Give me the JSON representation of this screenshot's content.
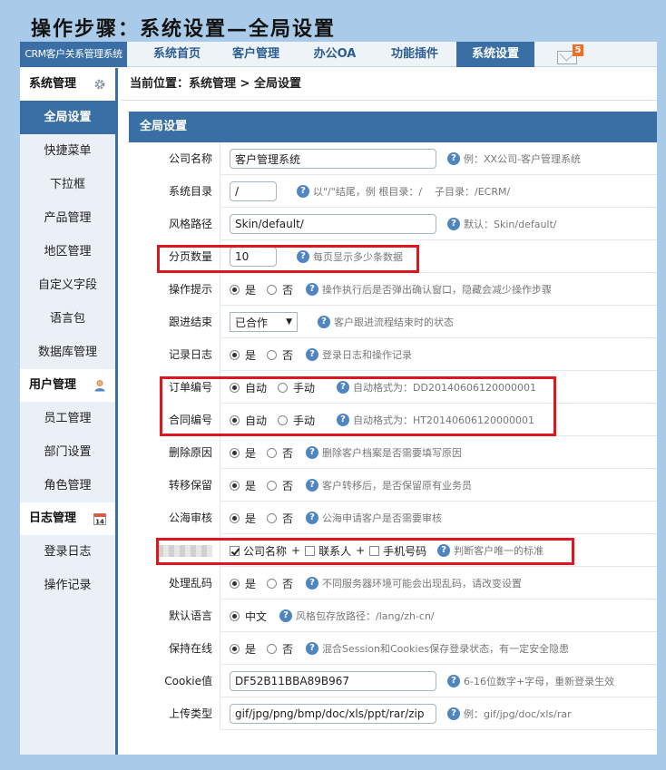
{
  "caption": "操作步骤：系统设置—全局设置",
  "brand": "CRM客户关系管理系统",
  "nav": [
    {
      "label": "系统首页"
    },
    {
      "label": "客户管理"
    },
    {
      "label": "办公OA"
    },
    {
      "label": "功能插件"
    },
    {
      "label": "系统设置",
      "active": true
    }
  ],
  "mail_badge": "5",
  "sidebar": {
    "sections": [
      {
        "title": "系统管理",
        "icon": "gear-icon",
        "items": [
          "全局设置",
          "快捷菜单",
          "下拉框",
          "产品管理",
          "地区管理",
          "自定义字段",
          "语言包",
          "数据库管理"
        ]
      },
      {
        "title": "用户管理",
        "icon": "user-icon",
        "items": [
          "员工管理",
          "部门设置",
          "角色管理"
        ]
      },
      {
        "title": "日志管理",
        "icon": "calendar-icon",
        "calendar_day": "14",
        "items": [
          "登录日志",
          "操作记录"
        ]
      }
    ]
  },
  "breadcrumb": "当前位置：系统管理 > 全局设置",
  "panel_title": "全局设置",
  "fields": {
    "company_name": {
      "label": "公司名称",
      "value": "客户管理系统",
      "help": "例：XX公司-客户管理系统"
    },
    "sys_dir": {
      "label": "系统目录",
      "value": "/",
      "help": "以\"/\"结尾，例 根目录：/    子目录：/ECRM/"
    },
    "skin_path": {
      "label": "风格路径",
      "value": "Skin/default/",
      "help": "默认：Skin/default/"
    },
    "page_size": {
      "label": "分页数量",
      "value": "10",
      "help": "每页显示多少条数据"
    },
    "op_tip": {
      "label": "操作提示",
      "yes": "是",
      "no": "否",
      "help": "操作执行后是否弹出确认窗口，隐藏会减少操作步骤"
    },
    "follow_end": {
      "label": "跟进结束",
      "value": "已合作",
      "help": "客户跟进流程结束时的状态"
    },
    "log_record": {
      "label": "记录日志",
      "yes": "是",
      "no": "否",
      "help": "登录日志和操作记录"
    },
    "order_no": {
      "label": "订单编号",
      "auto": "自动",
      "manual": "手动",
      "help": "自动格式为：DD20140606120000001"
    },
    "contract_no": {
      "label": "合同编号",
      "auto": "自动",
      "manual": "手动",
      "help": "自动格式为：HT20140606120000001"
    },
    "delete_reason": {
      "label": "删除原因",
      "yes": "是",
      "no": "否",
      "help": "删除客户档案是否需要填写原因"
    },
    "transfer_keep": {
      "label": "转移保留",
      "yes": "是",
      "no": "否",
      "help": "客户转移后，是否保留原有业务员"
    },
    "sea_review": {
      "label": "公海审核",
      "yes": "是",
      "no": "否",
      "help": "公海申请客户是否需要审核"
    },
    "unique": {
      "opt1": "公司名称",
      "opt2": "联系人",
      "opt3": "手机号码",
      "plus": "+",
      "help": "判断客户唯一的标准"
    },
    "garble": {
      "label": "处理乱码",
      "yes": "是",
      "no": "否",
      "help": "不同服务器环境可能会出现乱码，请改变设置"
    },
    "lang": {
      "label": "默认语言",
      "value": "中文",
      "help": "风格包存放路径：/lang/zh-cn/"
    },
    "online": {
      "label": "保持在线",
      "yes": "是",
      "no": "否",
      "help": "混合Session和Cookies保存登录状态，有一定安全隐患"
    },
    "cookie": {
      "label": "Cookie值",
      "value": "DF52B11BBA89B967",
      "help": "6-16位数字+字母，重新登录生效"
    },
    "upload": {
      "label": "上传类型",
      "value": "gif/jpg/png/bmp/doc/xls/ppt/rar/zip",
      "help": "例：gif/jpg/doc/xls/rar"
    }
  },
  "help_glyph": "?"
}
